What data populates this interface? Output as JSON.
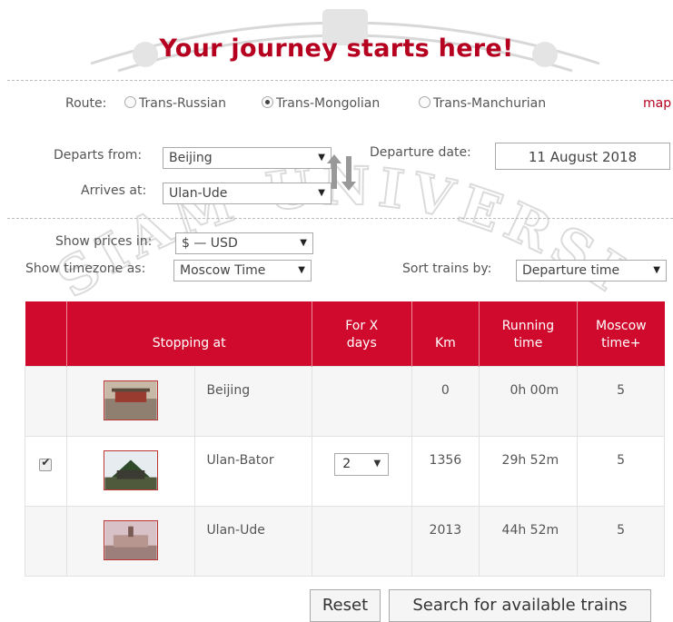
{
  "title": "Your journey starts here!",
  "route": {
    "label": "Route:",
    "options": [
      "Trans-Russian",
      "Trans-Mongolian",
      "Trans-Manchurian"
    ],
    "selected": "Trans-Mongolian",
    "map_link": "map"
  },
  "departs": {
    "label": "Departs from:",
    "value": "Beijing"
  },
  "arrives": {
    "label": "Arrives at:",
    "value": "Ulan-Ude"
  },
  "departure_date": {
    "label": "Departure date:",
    "value": "11 August 2018"
  },
  "prices": {
    "label": "Show prices in:",
    "value": "$ — USD"
  },
  "timezone": {
    "label": "Show timezone as:",
    "value": "Moscow Time"
  },
  "sort": {
    "label": "Sort trains by:",
    "value": "Departure time"
  },
  "table": {
    "headers": {
      "stopping_at": "Stopping at",
      "for_x_days_1": "For X",
      "for_x_days_2": "days",
      "km": "Km",
      "running_1": "Running",
      "running_2": "time",
      "moscow_1": "Moscow",
      "moscow_2": "time+"
    },
    "rows": [
      {
        "name": "Beijing",
        "days": "",
        "km": "0",
        "running": "0h 00m",
        "moscow": "5",
        "checked": false
      },
      {
        "name": "Ulan-Bator",
        "days": "2",
        "km": "1356",
        "running": "29h 52m",
        "moscow": "5",
        "checked": true
      },
      {
        "name": "Ulan-Ude",
        "days": "",
        "km": "2013",
        "running": "44h 52m",
        "moscow": "5",
        "checked": false
      }
    ]
  },
  "buttons": {
    "reset": "Reset",
    "search": "Search for available trains"
  },
  "watermark": {
    "text": "SIAM UNIVERSITY"
  },
  "colors": {
    "accent": "#cf0a2c",
    "title": "#b5001f"
  }
}
